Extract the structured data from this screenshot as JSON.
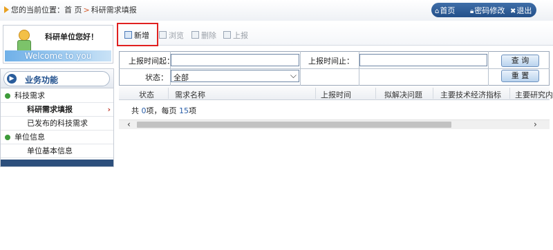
{
  "breadcrumb": {
    "prefix": "您的当前位置：",
    "home": "首 页",
    "separator": ">",
    "current": "科研需求填报"
  },
  "top_links": {
    "home": "首页",
    "password": "密码修改",
    "logout": "退出"
  },
  "welcome": {
    "greeting": "科研单位您好！",
    "banner": "Welcome to you"
  },
  "sidebar": {
    "title": "业务功能",
    "groups": [
      {
        "label": "科技需求",
        "items": [
          {
            "label": "科研需求填报",
            "selected": true
          },
          {
            "label": "已发布的科技需求",
            "selected": false
          }
        ]
      },
      {
        "label": "单位信息",
        "items": [
          {
            "label": "单位基本信息",
            "selected": false
          }
        ]
      }
    ],
    "arrow": "›"
  },
  "toolbar": {
    "add": "新增",
    "browse": "浏览",
    "delete": "删除",
    "report": "上报"
  },
  "search": {
    "from_label": "上报时间起：",
    "to_label": "上报时间止：",
    "status_label": "状态：",
    "status_value": "全部",
    "query_button": "查 询",
    "reset_button": "重 置",
    "from_value": "",
    "to_value": ""
  },
  "grid": {
    "columns": [
      "状态",
      "需求名称",
      "上报时间",
      "拟解决问题",
      "主要技术经济指标",
      "主要研究内"
    ],
    "footer": {
      "pre": "共 ",
      "total": "0",
      "mid": "项，每页 ",
      "per_page": "15",
      "post": "项"
    }
  },
  "colors": {
    "accent_blue": "#2a5d9c",
    "highlight_red": "#e02020",
    "group_dot_green": "#3e9b3a"
  }
}
